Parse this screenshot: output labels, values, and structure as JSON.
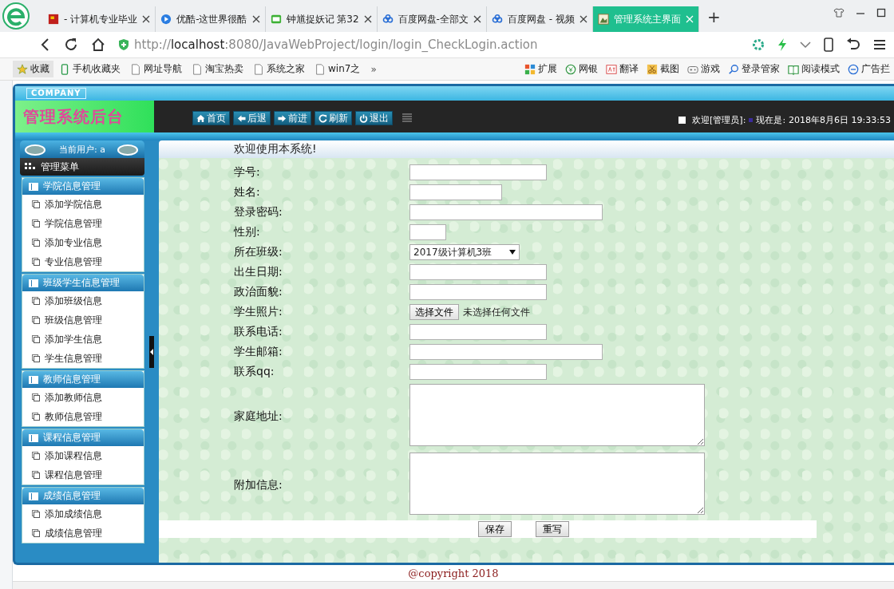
{
  "browser": {
    "tabs": [
      {
        "title": "- 计算机专业毕业",
        "selected": false
      },
      {
        "title": "优酷-这世界很酷",
        "selected": false
      },
      {
        "title": "钟馗捉妖记 第32",
        "selected": false
      },
      {
        "title": "百度网盘-全部文",
        "selected": false
      },
      {
        "title": "百度网盘 - 视频",
        "selected": false
      },
      {
        "title": "管理系统主界面",
        "selected": true
      }
    ],
    "new_tab": "+",
    "url": "http://**localhost**:8080/JavaWebProject/login/login_CheckLogin.action",
    "bookmarks": [
      "收藏",
      "手机收藏夹",
      "网址导航",
      "淘宝热卖",
      "系统之家",
      "win7之"
    ],
    "more": "»",
    "tools": [
      "扩展",
      "网银",
      "翻译",
      "截图",
      "游戏",
      "登录管家",
      "阅读模式",
      "广告拦"
    ]
  },
  "app": {
    "company": "COMPANY",
    "title": "管理系统后台",
    "nav": [
      "首页",
      "后退",
      "前进",
      "刷新",
      "退出"
    ],
    "welcome": "欢迎[管理员]:",
    "now_label": "现在是:",
    "now": "2018年8月6日 19:33:53",
    "sidebar": {
      "current_user": "当前用户: a",
      "menu_title": "管理菜单",
      "groups": [
        {
          "title": "学院信息管理",
          "items": [
            "添加学院信息",
            "学院信息管理",
            "添加专业信息",
            "专业信息管理"
          ]
        },
        {
          "title": "班级学生信息管理",
          "items": [
            "添加班级信息",
            "班级信息管理",
            "添加学生信息",
            "学生信息管理"
          ]
        },
        {
          "title": "教师信息管理",
          "items": [
            "添加教师信息",
            "教师信息管理"
          ]
        },
        {
          "title": "课程信息管理",
          "items": [
            "添加课程信息",
            "课程信息管理"
          ]
        },
        {
          "title": "成绩信息管理",
          "items": [
            "添加成绩信息",
            "成绩信息管理"
          ]
        }
      ]
    },
    "content_title": "欢迎使用本系统!",
    "form": [
      {
        "label": "学号:",
        "kind": "text"
      },
      {
        "label": "姓名:",
        "kind": "text"
      },
      {
        "label": "登录密码:",
        "kind": "text"
      },
      {
        "label": "性别:",
        "kind": "text"
      },
      {
        "label": "所在班级:",
        "kind": "select",
        "value": "2017级计算机3班"
      },
      {
        "label": "出生日期:",
        "kind": "text"
      },
      {
        "label": "政治面貌:",
        "kind": "text"
      },
      {
        "label": "学生照片:",
        "kind": "file",
        "button": "选择文件",
        "status": "未选择任何文件"
      },
      {
        "label": "联系电话:",
        "kind": "text"
      },
      {
        "label": "学生邮箱:",
        "kind": "text"
      },
      {
        "label": "联系qq:",
        "kind": "text"
      },
      {
        "label": "家庭地址:",
        "kind": "textarea"
      },
      {
        "label": "附加信息:",
        "kind": "textarea"
      }
    ],
    "buttons": [
      "保存",
      "重写"
    ],
    "footer": "@copyright 2018"
  }
}
